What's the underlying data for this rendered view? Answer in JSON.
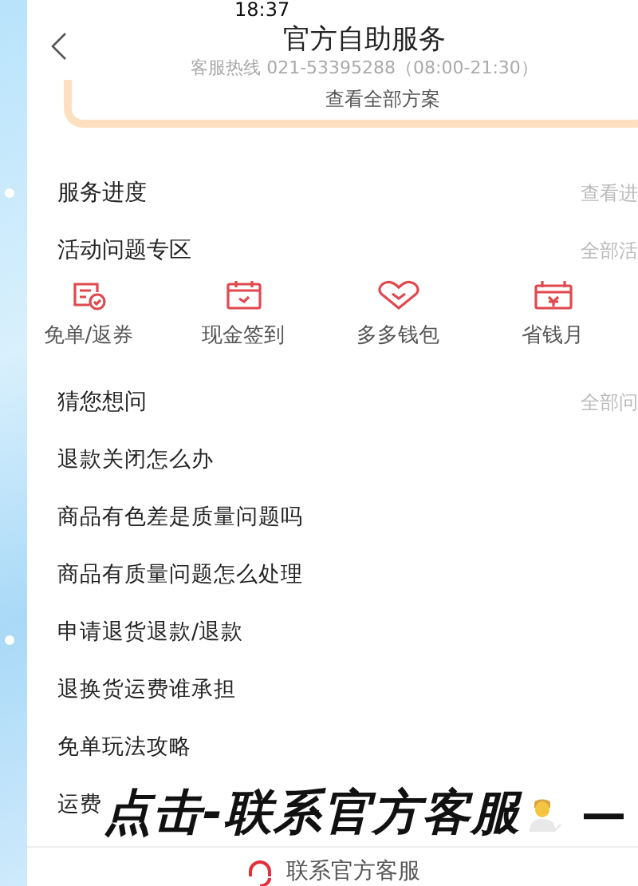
{
  "status_bar": {
    "time": "18:37"
  },
  "header": {
    "title": "官方自助服务",
    "hotline": "客服热线 021-53395288（08:00-21:30）",
    "plan_link": "查看全部方案"
  },
  "sections": [
    {
      "title": "服务进度",
      "link": "查看进"
    },
    {
      "title": "活动问题专区",
      "link": "全部活",
      "shortcuts": [
        {
          "label": "免单/返券",
          "kind": "coupon"
        },
        {
          "label": "现金签到",
          "kind": "calendar"
        },
        {
          "label": "多多钱包",
          "kind": "heart"
        },
        {
          "label": "省钱月",
          "kind": "card"
        }
      ]
    },
    {
      "title": "猜您想问",
      "link": "全部问",
      "questions": [
        "退款关闭怎么办",
        "商品有色差是质量问题吗",
        "商品有质量问题怎么处理",
        "申请退货退款/退款",
        "退换货运费谁承担",
        "免单玩法攻略",
        "运费"
      ]
    }
  ],
  "caption": {
    "text": "点击-联系官方客服",
    "tail": "—"
  },
  "footer": {
    "contact": "联系官方客服"
  }
}
